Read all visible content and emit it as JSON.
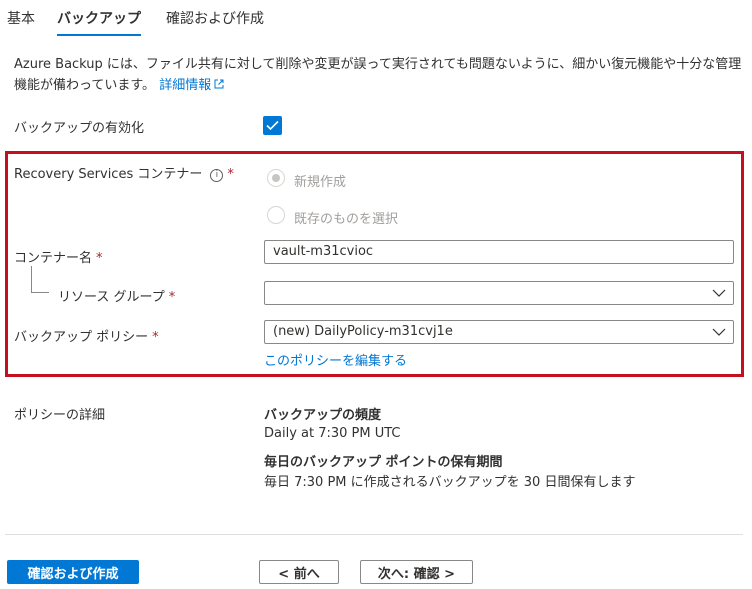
{
  "tabs": [
    {
      "label": "基本",
      "active": false
    },
    {
      "label": "バックアップ",
      "active": true
    },
    {
      "label": "確認および作成",
      "active": false
    }
  ],
  "description": {
    "text": "Azure Backup には、ファイル共有に対して削除や変更が誤って実行されても問題ないように、細かい復元機能や十分な管理機能が備わっています。",
    "link": "詳細情報"
  },
  "enable_backup": {
    "label": "バックアップの有効化",
    "checked": true
  },
  "recovery_services": {
    "label": "Recovery Services コンテナー",
    "required_mark": "*",
    "options": [
      {
        "label": "新規作成",
        "selected": true,
        "disabled": true
      },
      {
        "label": "既存のものを選択",
        "selected": false,
        "disabled": true
      }
    ]
  },
  "vault_name": {
    "label": "コンテナー名",
    "required_mark": "*",
    "value": "vault-m31cvioc"
  },
  "resource_group": {
    "label": "リソース グループ",
    "required_mark": "*",
    "value": ""
  },
  "backup_policy": {
    "label": "バックアップ ポリシー",
    "required_mark": "*",
    "value": "(new) DailyPolicy-m31cvj1e",
    "edit_link": "このポリシーを編集する"
  },
  "policy_details": {
    "label": "ポリシーの詳細",
    "frequency_title": "バックアップの頻度",
    "frequency_value": "Daily at 7:30 PM UTC",
    "retention_title": "毎日のバックアップ ポイントの保有期間",
    "retention_value": "毎日 7:30 PM に作成されるバックアップを 30 日間保有します"
  },
  "footer": {
    "review_create": "確認および作成",
    "previous": "< 前へ",
    "next": "次へ: 確認 >"
  },
  "colors": {
    "accent": "#0078d4",
    "highlight_border": "#c50f1f",
    "required": "#a4262c"
  }
}
